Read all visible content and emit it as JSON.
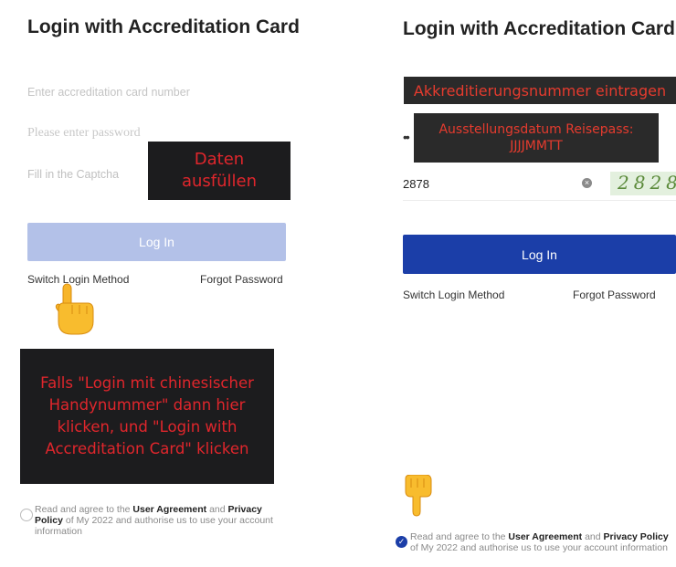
{
  "colors": {
    "disabled_button": "#b3c1e8",
    "active_button": "#1b3ea8",
    "annotation_bg": "#1c1c1e",
    "annotation_text": "#e0262c",
    "checkbox_checked": "#1b3ea8"
  },
  "left": {
    "title": "Login with Accreditation Card",
    "card_placeholder": "Enter accreditation card number",
    "password_placeholder": "Please enter password",
    "captcha_placeholder": "Fill in the Captcha",
    "login_button": "Log In",
    "switch_login": "Switch Login Method",
    "forgot_password": "Forgot Password",
    "note_fill": "Daten ausfüllen",
    "note_switch": "Falls \"Login mit chinesischer Handynummer\" dann hier klicken, und \"Login with Accreditation Card\" klicken",
    "agree_pre": "Read and agree to the ",
    "agree_user": "User Agreement",
    "agree_and": " and ",
    "agree_privacy": "Privacy Policy",
    "agree_post": " of My 2022 and authorise us to use your account information",
    "icons": [
      "pointing-hand-icon",
      "radio-unchecked-icon"
    ]
  },
  "right": {
    "title": "Login with Accreditation Card",
    "note_number": "Akkreditierungsnummer eintragen",
    "note_passport": "Ausstellungsdatum Reisepass: JJJJMMTT",
    "password_value": "••",
    "captcha_value": "2878",
    "captcha_image_text": "2828",
    "login_button": "Log In",
    "switch_login": "Switch Login Method",
    "forgot_password": "Forgot Password",
    "agree_pre": "Read and agree to the ",
    "agree_user": "User Agreement",
    "agree_and": " and ",
    "agree_privacy": "Privacy Policy",
    "agree_post": " of My 2022 and authorise us to use your account information",
    "icons": [
      "clear-icon",
      "pointing-down-hand-icon",
      "checkbox-checked-icon"
    ]
  }
}
